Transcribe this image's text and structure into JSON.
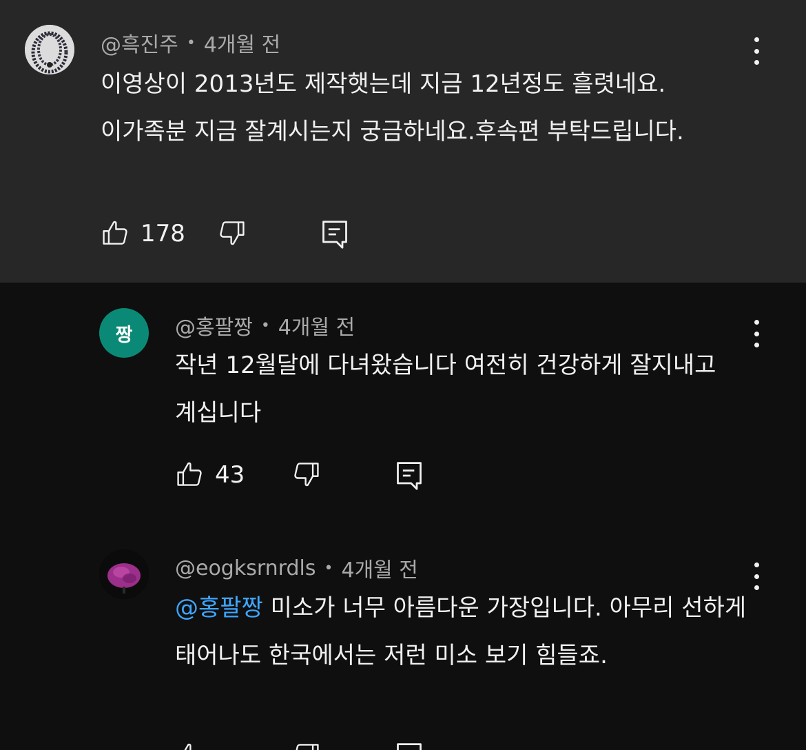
{
  "colors": {
    "parent_bg": "#272727",
    "page_bg": "#0f0f0f",
    "text": "#f1f1f1",
    "meta": "#aaaaaa",
    "mention": "#3ea6ff",
    "avatar_teal": "#0a8a76"
  },
  "comments": [
    {
      "author": "@흑진주",
      "time": "4개월 전",
      "text": "이영상이 2013년도 제작햇는데 지금 12년정도 흘렷네요. 이가족분  지금 잘계시는지 궁금하네요.후속편  부탁드립니다.",
      "likes": "178",
      "avatar_icon": "pearl-necklace-avatar"
    },
    {
      "author": "@홍팔짱",
      "time": "4개월 전",
      "text": "작년 12월달에 다녀왔습니다 여전히 건강하게 잘지내고 계십니다",
      "likes": "43",
      "avatar_letter": "짱"
    },
    {
      "author": "@eogksrnrdls",
      "time": "4개월 전",
      "mention": "@홍팔짱",
      "text": " 미소가 너무 아름다운 가장입니다. 아무리 선하게 태어나도 한국에서는 저런 미소 보기 힘들죠.",
      "avatar_icon": "purple-flower-avatar"
    }
  ],
  "separator": "•",
  "icons": {
    "like": "thumbs-up-icon",
    "dislike": "thumbs-down-icon",
    "reply": "reply-comment-icon",
    "more": "more-vertical-icon"
  }
}
